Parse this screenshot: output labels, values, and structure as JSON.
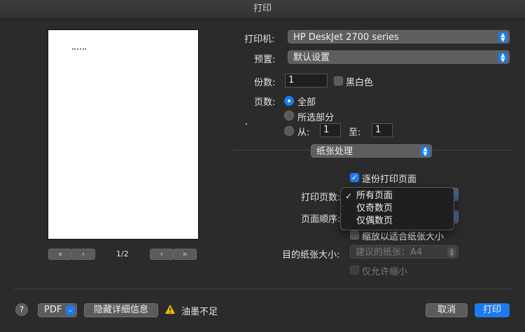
{
  "window": {
    "title": "打印"
  },
  "preview": {
    "page_indicator": "1/2",
    "nav": {
      "first": "«",
      "prev": "‹",
      "next": "›",
      "last": "»"
    }
  },
  "printer": {
    "label": "打印机:",
    "value": "HP DeskJet 2700 series"
  },
  "presets": {
    "label": "预置:",
    "value": "默认设置"
  },
  "copies": {
    "label": "份数:",
    "value": "1",
    "bw_label": "黑白色",
    "bw_checked": false
  },
  "pages": {
    "label": "页数:",
    "options": {
      "all": "全部",
      "selection": "所选部分",
      "range": "从:"
    },
    "selected": "all",
    "from": "1",
    "to_label": "至:",
    "to": "1"
  },
  "section_select": {
    "value": "纸张处理"
  },
  "paper_handling": {
    "collate_label": "逐份打印页面",
    "collate_checked": true,
    "pages_to_print_label": "打印页数:",
    "page_order_label": "页面顺序:",
    "scale_label": "缩放以适合纸张大小",
    "scale_checked": false,
    "dest_size_label": "目的纸张大小:",
    "dest_size_value": "建议的纸张：A4",
    "scale_down_only_label": "仅允许缩小",
    "scale_down_only_checked": false
  },
  "dropdown_menu": {
    "items": [
      "所有页面",
      "仅奇数页",
      "仅偶数页"
    ],
    "selected_index": 0
  },
  "footer": {
    "help": "?",
    "pdf_label": "PDF",
    "hide_details": "隐藏详细信息",
    "warning_text": "油墨不足",
    "cancel": "取消",
    "print": "打印"
  },
  "colors": {
    "accent": "#1c7bf0",
    "background": "#2b2b2b",
    "warning": "#f5c400"
  }
}
